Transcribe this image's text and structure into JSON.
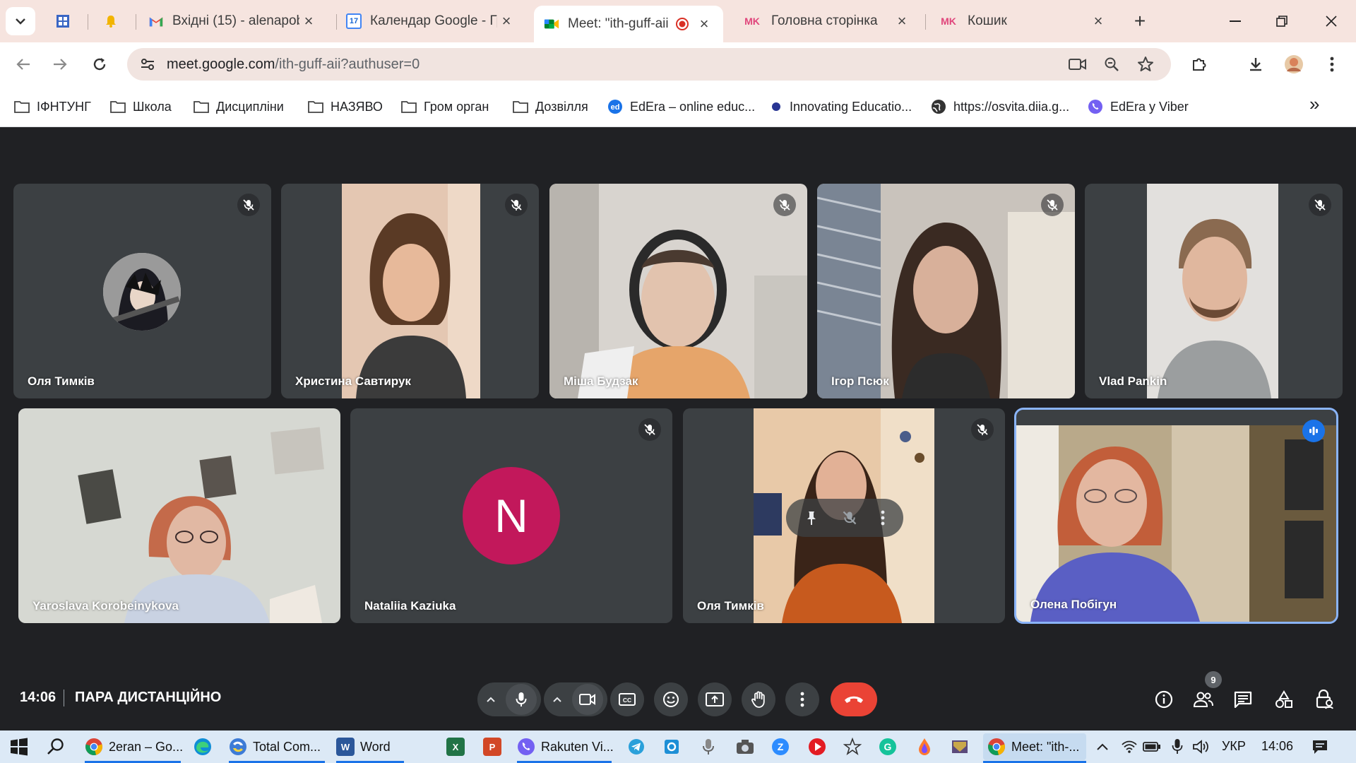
{
  "browser": {
    "tabs": [
      {
        "title": "",
        "kind": "sheets"
      },
      {
        "title": "",
        "kind": "bell"
      },
      {
        "title": "Вхідні (15) - alenapob",
        "kind": "gmail"
      },
      {
        "title": "Календар Google - Гр",
        "kind": "calendar"
      },
      {
        "title": "Meet: \"ith-guff-aii",
        "kind": "meet"
      },
      {
        "title": "Головна сторінка",
        "kind": "mk"
      },
      {
        "title": "Кошик",
        "kind": "mk"
      }
    ],
    "mk_label": "MK",
    "calendar_day": "17",
    "url": {
      "host": "meet.google.com",
      "path": "/ith-guff-aii?authuser=0"
    },
    "bookmarks": [
      {
        "label": "ІФНТУНГ",
        "icon": "folder-icon"
      },
      {
        "label": "Школа",
        "icon": "folder-icon"
      },
      {
        "label": "Дисципліни",
        "icon": "folder-icon"
      },
      {
        "label": "НАЗЯВО",
        "icon": "folder-icon"
      },
      {
        "label": "Гром орган",
        "icon": "folder-icon"
      },
      {
        "label": "Дозвілля",
        "icon": "folder-icon"
      },
      {
        "label": "EdEra – online educ...",
        "icon": "edera-icon"
      },
      {
        "label": "Innovating Educatio...",
        "icon": "dot-icon"
      },
      {
        "label": "https://osvita.diia.g...",
        "icon": "globe-icon"
      },
      {
        "label": "EdEra у Viber",
        "icon": "viber-icon"
      }
    ],
    "more_bookmarks": "»"
  },
  "meet": {
    "participants_row1": [
      {
        "name": "Оля Тимків",
        "type": "avatar-image",
        "muted": true
      },
      {
        "name": "Христина Савтирук",
        "type": "video",
        "muted": true
      },
      {
        "name": "Міша Будзак",
        "type": "video",
        "muted": true
      },
      {
        "name": "Ігор Псюк",
        "type": "video",
        "muted": true
      },
      {
        "name": "Vlad Pankin",
        "type": "video",
        "muted": true
      }
    ],
    "participants_row2": [
      {
        "name": "Yaroslava Korobeinykova",
        "type": "video",
        "muted": false
      },
      {
        "name": "Nataliia Kaziuka",
        "type": "avatar-letter",
        "letter": "N",
        "muted": true
      },
      {
        "name": "Оля Тимків",
        "type": "video",
        "muted": true
      },
      {
        "name": "Олена Побігун",
        "type": "video",
        "muted": false,
        "speaking": true
      }
    ],
    "avatar_color": "#c2185b",
    "speaker_color": "#8ab4f8",
    "clock": "14:06",
    "meeting_title": "ПАРА ДИСТАНЦІЙНО",
    "people_count": "9",
    "end_call_color": "#ea4335"
  },
  "taskbar": {
    "apps": [
      {
        "label": "2eran – Go...",
        "icon": "chrome-icon"
      },
      {
        "label": "",
        "icon": "edge-icon"
      },
      {
        "label": "Total Com...",
        "icon": "totalcommander-icon"
      },
      {
        "label": "Word",
        "icon": "word-icon"
      },
      {
        "label": "",
        "icon": "excel-icon"
      },
      {
        "label": "",
        "icon": "powerpoint-icon"
      },
      {
        "label": "Rakuten Vi...",
        "icon": "viber-icon"
      },
      {
        "label": "Meet: \"ith-...",
        "icon": "chrome-icon"
      }
    ],
    "word_letter": "W",
    "excel_letter": "X",
    "ppt_letter": "P",
    "lang": "УКР",
    "time": "14:06"
  }
}
